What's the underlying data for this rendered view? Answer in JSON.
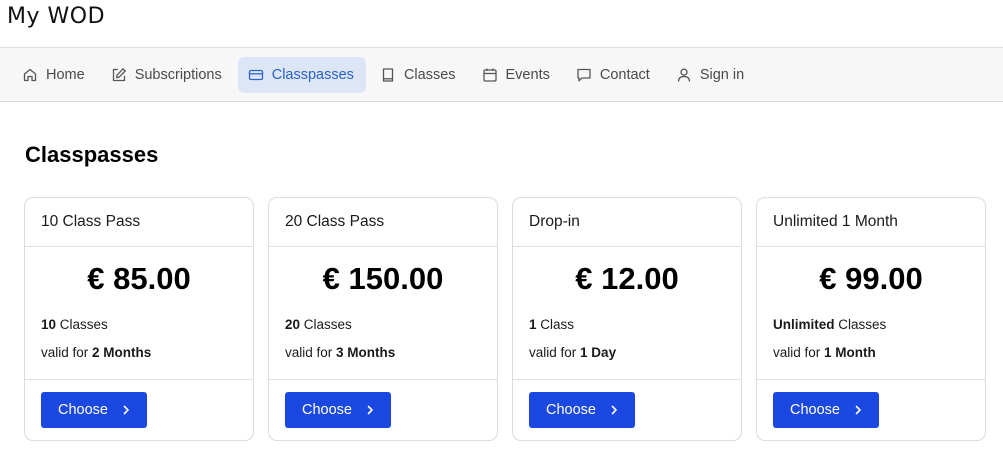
{
  "app": {
    "title": "My WOD"
  },
  "nav": {
    "items": [
      {
        "label": "Home",
        "icon": "home-icon"
      },
      {
        "label": "Subscriptions",
        "icon": "edit-icon"
      },
      {
        "label": "Classpasses",
        "icon": "credit-card-icon",
        "active": true
      },
      {
        "label": "Classes",
        "icon": "book-icon"
      },
      {
        "label": "Events",
        "icon": "calendar-icon"
      },
      {
        "label": "Contact",
        "icon": "message-icon"
      },
      {
        "label": "Sign in",
        "icon": "user-icon"
      }
    ],
    "active_color": "#2a63c8",
    "active_bg": "#dde6f7"
  },
  "page": {
    "title": "Classpasses"
  },
  "cards": [
    {
      "name": "10 Class Pass",
      "price": "€ 85.00",
      "classes_value": "10",
      "classes_unit": "Classes",
      "valid_prefix": "valid for",
      "valid_value": "2 Months",
      "button": "Choose"
    },
    {
      "name": "20 Class Pass",
      "price": "€ 150.00",
      "classes_value": "20",
      "classes_unit": "Classes",
      "valid_prefix": "valid for",
      "valid_value": "3 Months",
      "button": "Choose"
    },
    {
      "name": "Drop-in",
      "price": "€ 12.00",
      "classes_value": "1",
      "classes_unit": "Class",
      "valid_prefix": "valid for",
      "valid_value": "1 Day",
      "button": "Choose"
    },
    {
      "name": "Unlimited 1 Month",
      "price": "€ 99.00",
      "classes_value": "Unlimited",
      "classes_unit": "Classes",
      "valid_prefix": "valid for",
      "valid_value": "1 Month",
      "button": "Choose"
    }
  ],
  "colors": {
    "button": "#1b48e0"
  }
}
